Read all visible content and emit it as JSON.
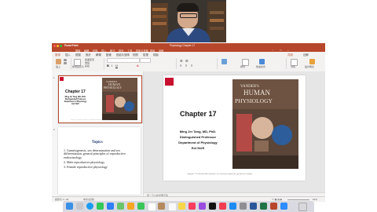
{
  "window": {
    "app_name": "PowerPoint",
    "doc_title": "Physiology Chapter 17",
    "menu_items": [
      "檔案",
      "編輯",
      "檢視",
      "插入",
      "格式",
      "排列",
      "工具",
      "投影片放映",
      "視窗",
      "說明"
    ],
    "ribbon_tabs": [
      "常用",
      "插入",
      "繪圖",
      "設計",
      "轉場",
      "動畫",
      "投影片放映",
      "校閱",
      "檢視",
      "錄製"
    ],
    "active_tab": "常用",
    "ribbon_labels": [
      "貼上",
      "新增投影片",
      "版面配置",
      "重設",
      "區段",
      "排列",
      "快速樣式",
      "尋找",
      "設計概念"
    ],
    "share": "共用",
    "comments": "註解"
  },
  "slide1": {
    "number": "1",
    "title": "Chapter 17",
    "author": "Ming Jer Tang, MD, PhD.",
    "position": "Distinguished Professor",
    "department": "Department of Physiology",
    "ext": "Ext 5425",
    "book_series": "VANDER'S",
    "book_title_1": "HUMAN",
    "book_title_2": "PHYSIOLOGY",
    "copyright": "Copyright © The McGraw-Hill Companies, Inc. Permission required for reproduction or display."
  },
  "slide2": {
    "number": "2",
    "heading": "Topics",
    "items": [
      "1.  Gametogenesis, sex determination and sex differentiation, general principles of reproductive endocrinology",
      "2.  Male reproductive physiology",
      "3.  Female reproductive physiology"
    ]
  },
  "notes_placeholder": "按一下以新增備忘稿",
  "status": {
    "slide_info": "投影片 1 / 29",
    "language": "中文(台灣)",
    "zoom": "62%"
  },
  "colors": {
    "accent": "#b7472a",
    "logo_red": "#c8102e",
    "dock": "#d2d4dc"
  },
  "dock_icons": [
    "finder",
    "launchpad",
    "safari",
    "messages",
    "mail",
    "maps",
    "photos",
    "facetime",
    "calendar",
    "contacts",
    "reminders",
    "notes",
    "music",
    "podcasts",
    "tv",
    "news",
    "app-store",
    "system-preferences",
    "word",
    "excel",
    "powerpoint",
    "zoom",
    "trash"
  ]
}
